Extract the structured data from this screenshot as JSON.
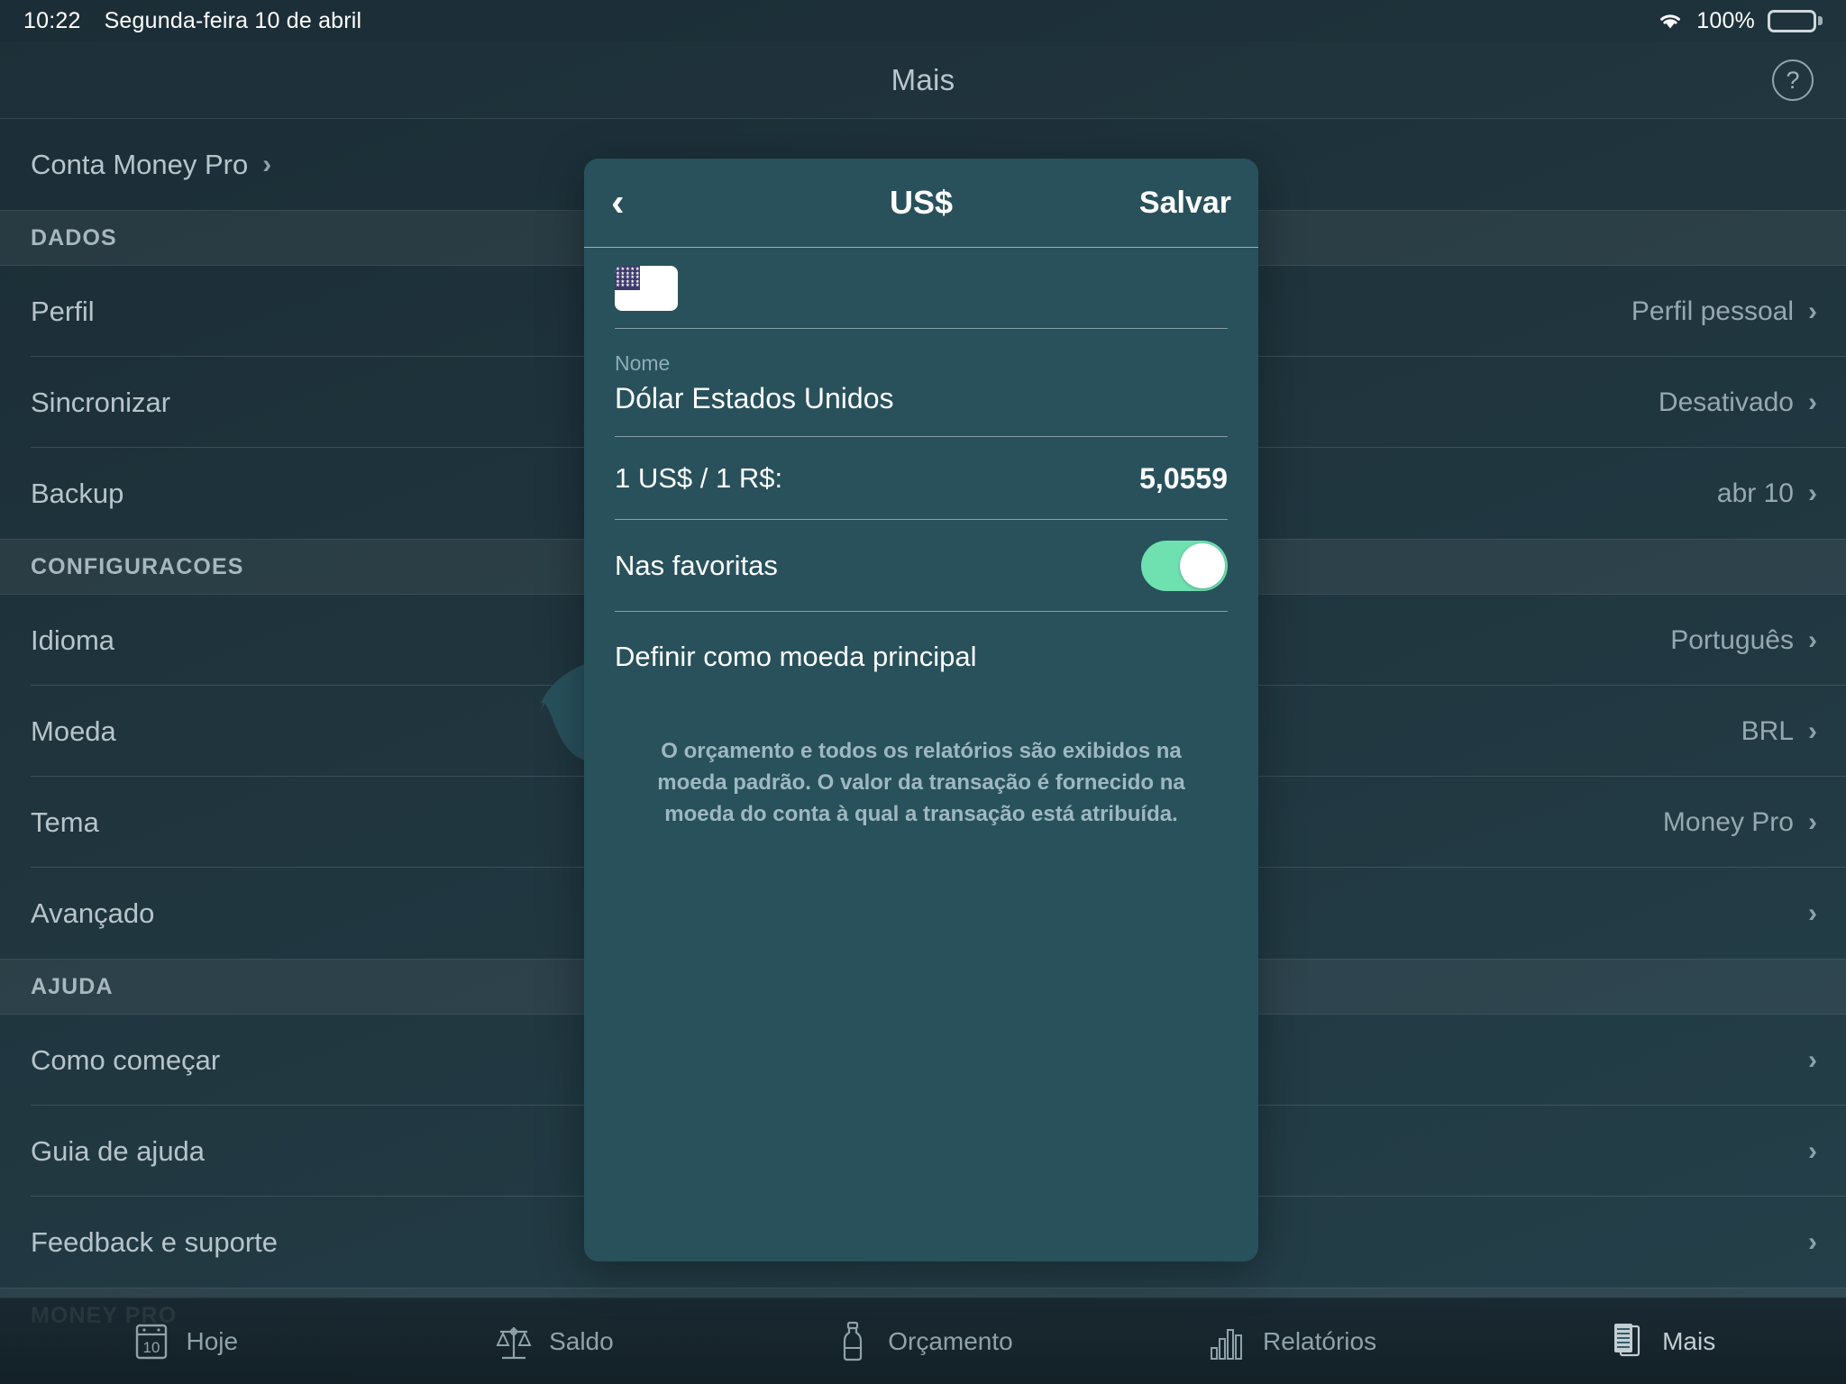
{
  "status_bar": {
    "time": "10:22",
    "date": "Segunda-feira 10 de abril",
    "battery_percent": "100%",
    "wifi_icon": "wifi-icon",
    "battery_icon": "battery-full-icon"
  },
  "nav": {
    "title": "Mais",
    "help_label": "?",
    "help_icon": "question-mark-circle-icon"
  },
  "settings": {
    "account_row": {
      "label": "Conta Money Pro",
      "value": "",
      "chevron": "›"
    },
    "sections": [
      {
        "header": "DADOS",
        "rows": [
          {
            "label": "Perfil",
            "value": "Perfil pessoal",
            "chevron": "›"
          },
          {
            "label": "Sincronizar",
            "value": "Desativado",
            "chevron": "›"
          },
          {
            "label": "Backup",
            "value": "abr 10",
            "chevron": "›"
          }
        ]
      },
      {
        "header": "CONFIGURACOES",
        "rows": [
          {
            "label": "Idioma",
            "value": "Português",
            "chevron": "›"
          },
          {
            "label": "Moeda",
            "value": "BRL",
            "chevron": "›"
          },
          {
            "label": "Tema",
            "value": "Money Pro",
            "chevron": "›"
          },
          {
            "label": "Avançado",
            "value": "",
            "chevron": "›"
          }
        ]
      },
      {
        "header": "AJUDA",
        "rows": [
          {
            "label": "Como começar",
            "value": "",
            "chevron": "›"
          },
          {
            "label": "Guia de ajuda",
            "value": "",
            "chevron": "›"
          },
          {
            "label": "Feedback e suporte",
            "value": "",
            "chevron": "›"
          }
        ]
      },
      {
        "header": "MONEY PRO",
        "rows": []
      }
    ]
  },
  "popover": {
    "back_icon": "chevron-left-icon",
    "title": "US$",
    "save_label": "Salvar",
    "flag_icon": "us-flag-icon",
    "name_label": "Nome",
    "name_value": "Dólar Estados Unidos",
    "rate_label": "1 US$ / 1 R$:",
    "rate_value": "5,0559",
    "favorite_label": "Nas favoritas",
    "favorite_on": true,
    "set_main_label": "Definir como moeda principal",
    "note": "O orçamento e todos os relatórios são exibidos na moeda padrão. O valor da transação é fornecido na moeda do conta à qual a transação está atribuída.",
    "accent_color": "#6fe0b0",
    "background_color": "#28515c"
  },
  "tabbar": {
    "tabs": [
      {
        "label": "Hoje",
        "icon": "calendar-icon",
        "day": "10",
        "active": false
      },
      {
        "label": "Saldo",
        "icon": "scales-icon",
        "active": false
      },
      {
        "label": "Orçamento",
        "icon": "bottle-icon",
        "active": false
      },
      {
        "label": "Relatórios",
        "icon": "bar-chart-icon",
        "active": false
      },
      {
        "label": "Mais",
        "icon": "documents-icon",
        "active": true
      }
    ]
  }
}
